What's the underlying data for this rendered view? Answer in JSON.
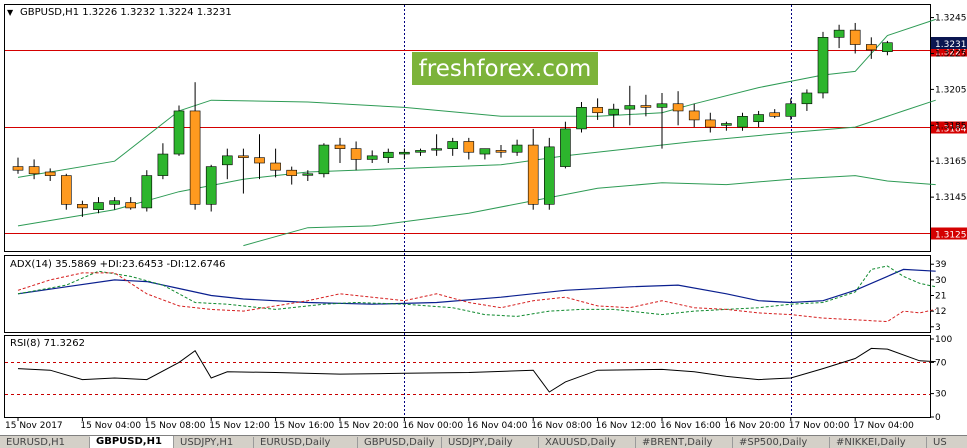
{
  "colors": {
    "bull": "#2db52d",
    "bear": "#ff9a1f",
    "bollinger": "#2e9b55",
    "level_line": "#d40000",
    "separator": "#00007f",
    "adx_line": "#0a1f8f",
    "plus_di": "#0f8a2e",
    "minus_di": "#d62020",
    "rsi_line": "#000000",
    "rsi_level": "#c80000",
    "watermark_bg": "#7cb33a",
    "current_price_bg": "#0b1650"
  },
  "watermark": "freshforex.com",
  "tabs": [
    {
      "label": "EURUSD,H1",
      "active": false
    },
    {
      "label": "GBPUSD,H1",
      "active": true
    },
    {
      "label": "USDJPY,H1",
      "active": false
    },
    {
      "label": "EURUSD,Daily",
      "active": false
    },
    {
      "label": "GBPUSD,Daily",
      "active": false
    },
    {
      "label": "USDJPY,Daily",
      "active": false
    },
    {
      "label": "XAUUSD,Daily",
      "active": false
    },
    {
      "label": "#BRENT,Daily",
      "active": false
    },
    {
      "label": "#SP500,Daily",
      "active": false
    },
    {
      "label": "#NIKKEI,Daily",
      "active": false
    },
    {
      "label": "US",
      "active": false
    }
  ],
  "chart_data": [
    {
      "type": "candlestick",
      "title": "GBPUSD,H1  1.3226 1.3232 1.3224 1.3231",
      "symbol_arrow": "▼",
      "ylim": [
        1.3115,
        1.3252
      ],
      "yticks": [
        "1.3245",
        "1.3225",
        "1.3205",
        "1.3185",
        "1.3165",
        "1.3145"
      ],
      "ytick_values": [
        1.3245,
        1.3225,
        1.3205,
        1.3185,
        1.3165,
        1.3145
      ],
      "horizontal_levels": [
        {
          "value": 1.3227,
          "label": "1.3227"
        },
        {
          "value": 1.3184,
          "label": "1.3184"
        },
        {
          "value": 1.3125,
          "label": "1.3125"
        }
      ],
      "current_price": {
        "value": 1.3231,
        "label": "1.3231"
      },
      "day_separators_at_index": [
        24,
        48
      ],
      "candles": [
        {
          "o": 1.3162,
          "h": 1.3167,
          "l": 1.3158,
          "c": 1.316
        },
        {
          "o": 1.3162,
          "h": 1.3166,
          "l": 1.3155,
          "c": 1.3158
        },
        {
          "o": 1.3159,
          "h": 1.3161,
          "l": 1.3154,
          "c": 1.3157
        },
        {
          "o": 1.3157,
          "h": 1.3158,
          "l": 1.3138,
          "c": 1.3141
        },
        {
          "o": 1.3141,
          "h": 1.3143,
          "l": 1.3134,
          "c": 1.3139
        },
        {
          "o": 1.3138,
          "h": 1.3145,
          "l": 1.3136,
          "c": 1.3142
        },
        {
          "o": 1.3141,
          "h": 1.3145,
          "l": 1.3138,
          "c": 1.3143
        },
        {
          "o": 1.3142,
          "h": 1.3145,
          "l": 1.3138,
          "c": 1.3139
        },
        {
          "o": 1.3139,
          "h": 1.316,
          "l": 1.3137,
          "c": 1.3157
        },
        {
          "o": 1.3157,
          "h": 1.3175,
          "l": 1.3155,
          "c": 1.3169
        },
        {
          "o": 1.3169,
          "h": 1.3196,
          "l": 1.3168,
          "c": 1.3193
        },
        {
          "o": 1.3193,
          "h": 1.3209,
          "l": 1.3138,
          "c": 1.3141
        },
        {
          "o": 1.3141,
          "h": 1.3163,
          "l": 1.3137,
          "c": 1.3162
        },
        {
          "o": 1.3163,
          "h": 1.3172,
          "l": 1.3155,
          "c": 1.3168
        },
        {
          "o": 1.3168,
          "h": 1.3172,
          "l": 1.3147,
          "c": 1.3167
        },
        {
          "o": 1.3167,
          "h": 1.318,
          "l": 1.3155,
          "c": 1.3164
        },
        {
          "o": 1.3164,
          "h": 1.3172,
          "l": 1.3156,
          "c": 1.316
        },
        {
          "o": 1.316,
          "h": 1.3162,
          "l": 1.3152,
          "c": 1.3157
        },
        {
          "o": 1.3158,
          "h": 1.316,
          "l": 1.3154,
          "c": 1.3158
        },
        {
          "o": 1.3158,
          "h": 1.3175,
          "l": 1.3156,
          "c": 1.3174
        },
        {
          "o": 1.3174,
          "h": 1.3178,
          "l": 1.3164,
          "c": 1.3172
        },
        {
          "o": 1.3172,
          "h": 1.3176,
          "l": 1.316,
          "c": 1.3166
        },
        {
          "o": 1.3166,
          "h": 1.3171,
          "l": 1.3164,
          "c": 1.3168
        },
        {
          "o": 1.3167,
          "h": 1.3172,
          "l": 1.3164,
          "c": 1.317
        },
        {
          "o": 1.3169,
          "h": 1.3172,
          "l": 1.3166,
          "c": 1.317
        },
        {
          "o": 1.317,
          "h": 1.3172,
          "l": 1.3168,
          "c": 1.3171
        },
        {
          "o": 1.3172,
          "h": 1.318,
          "l": 1.3168,
          "c": 1.3172
        },
        {
          "o": 1.3172,
          "h": 1.3178,
          "l": 1.3168,
          "c": 1.3176
        },
        {
          "o": 1.3176,
          "h": 1.3178,
          "l": 1.3166,
          "c": 1.317
        },
        {
          "o": 1.3169,
          "h": 1.3172,
          "l": 1.3166,
          "c": 1.3172
        },
        {
          "o": 1.3171,
          "h": 1.3174,
          "l": 1.3167,
          "c": 1.317
        },
        {
          "o": 1.317,
          "h": 1.3177,
          "l": 1.3168,
          "c": 1.3174
        },
        {
          "o": 1.3174,
          "h": 1.3183,
          "l": 1.3138,
          "c": 1.3141
        },
        {
          "o": 1.3141,
          "h": 1.3178,
          "l": 1.3138,
          "c": 1.3173
        },
        {
          "o": 1.3162,
          "h": 1.3187,
          "l": 1.3161,
          "c": 1.3183
        },
        {
          "o": 1.3183,
          "h": 1.3198,
          "l": 1.3181,
          "c": 1.3195
        },
        {
          "o": 1.3195,
          "h": 1.32,
          "l": 1.3188,
          "c": 1.3192
        },
        {
          "o": 1.3191,
          "h": 1.3197,
          "l": 1.3184,
          "c": 1.3194
        },
        {
          "o": 1.3194,
          "h": 1.3207,
          "l": 1.3185,
          "c": 1.3196
        },
        {
          "o": 1.3196,
          "h": 1.3202,
          "l": 1.319,
          "c": 1.3195
        },
        {
          "o": 1.3195,
          "h": 1.3203,
          "l": 1.3172,
          "c": 1.3197
        },
        {
          "o": 1.3197,
          "h": 1.3204,
          "l": 1.3185,
          "c": 1.3193
        },
        {
          "o": 1.3193,
          "h": 1.3197,
          "l": 1.3184,
          "c": 1.3188
        },
        {
          "o": 1.3188,
          "h": 1.3192,
          "l": 1.3181,
          "c": 1.3184
        },
        {
          "o": 1.3185,
          "h": 1.3187,
          "l": 1.3182,
          "c": 1.3186
        },
        {
          "o": 1.3184,
          "h": 1.3192,
          "l": 1.3182,
          "c": 1.319
        },
        {
          "o": 1.3187,
          "h": 1.3193,
          "l": 1.3184,
          "c": 1.3191
        },
        {
          "o": 1.3192,
          "h": 1.3194,
          "l": 1.3189,
          "c": 1.319
        },
        {
          "o": 1.319,
          "h": 1.32,
          "l": 1.3188,
          "c": 1.3197
        },
        {
          "o": 1.3197,
          "h": 1.3205,
          "l": 1.3193,
          "c": 1.3203
        },
        {
          "o": 1.3203,
          "h": 1.3237,
          "l": 1.32,
          "c": 1.3234
        },
        {
          "o": 1.3234,
          "h": 1.3241,
          "l": 1.3228,
          "c": 1.3238
        },
        {
          "o": 1.3238,
          "h": 1.3242,
          "l": 1.3225,
          "c": 1.323
        },
        {
          "o": 1.323,
          "h": 1.3234,
          "l": 1.3222,
          "c": 1.3227
        },
        {
          "o": 1.3226,
          "h": 1.3232,
          "l": 1.3224,
          "c": 1.3231
        }
      ],
      "bollinger": {
        "upper": [
          [
            0,
            1.3156
          ],
          [
            6,
            1.3165
          ],
          [
            10,
            1.3193
          ],
          [
            12,
            1.3199
          ],
          [
            18,
            1.3198
          ],
          [
            24,
            1.3195
          ],
          [
            30,
            1.319
          ],
          [
            36,
            1.319
          ],
          [
            40,
            1.3192
          ],
          [
            42,
            1.3197
          ],
          [
            46,
            1.3206
          ],
          [
            50,
            1.3213
          ],
          [
            52,
            1.3215
          ],
          [
            54,
            1.3235
          ],
          [
            57,
            1.3244
          ]
        ],
        "middle": [
          [
            0,
            1.3129
          ],
          [
            6,
            1.3138
          ],
          [
            10,
            1.3148
          ],
          [
            14,
            1.3155
          ],
          [
            18,
            1.3159
          ],
          [
            24,
            1.3161
          ],
          [
            30,
            1.3163
          ],
          [
            34,
            1.3168
          ],
          [
            38,
            1.3172
          ],
          [
            42,
            1.3176
          ],
          [
            48,
            1.3181
          ],
          [
            52,
            1.3184
          ],
          [
            55,
            1.3193
          ],
          [
            57,
            1.3199
          ]
        ],
        "lower": [
          [
            14,
            1.3118
          ],
          [
            18,
            1.3128
          ],
          [
            22,
            1.3129
          ],
          [
            28,
            1.3136
          ],
          [
            32,
            1.3143
          ],
          [
            36,
            1.315
          ],
          [
            40,
            1.3153
          ],
          [
            44,
            1.3152
          ],
          [
            48,
            1.3155
          ],
          [
            52,
            1.3157
          ],
          [
            54,
            1.3154
          ],
          [
            57,
            1.3152
          ]
        ]
      }
    },
    {
      "type": "line",
      "title": "ADX(14) 35.5869 +DI:23.6453 -DI:12.6746",
      "ylim": [
        0,
        42
      ],
      "yticks": [
        "39",
        "30",
        "21",
        "12",
        "3"
      ],
      "ytick_values": [
        39,
        30,
        21,
        12,
        3
      ],
      "series": [
        {
          "name": "ADX(14)",
          "values": [
            [
              0,
              22
            ],
            [
              3,
              26
            ],
            [
              6,
              30
            ],
            [
              8,
              29
            ],
            [
              10,
              25
            ],
            [
              12,
              21
            ],
            [
              14,
              19
            ],
            [
              18,
              17
            ],
            [
              22,
              16
            ],
            [
              26,
              17
            ],
            [
              30,
              20
            ],
            [
              34,
              24
            ],
            [
              38,
              26
            ],
            [
              41,
              27
            ],
            [
              44,
              22
            ],
            [
              46,
              18
            ],
            [
              48,
              17
            ],
            [
              50,
              18
            ],
            [
              52,
              24
            ],
            [
              54,
              32
            ],
            [
              55,
              36
            ],
            [
              57,
              35
            ]
          ]
        },
        {
          "name": "+DI",
          "values": [
            [
              0,
              22
            ],
            [
              3,
              27
            ],
            [
              5,
              35
            ],
            [
              7,
              32
            ],
            [
              9,
              27
            ],
            [
              11,
              17
            ],
            [
              13,
              16
            ],
            [
              16,
              13
            ],
            [
              19,
              16
            ],
            [
              21,
              17
            ],
            [
              24,
              16
            ],
            [
              27,
              14
            ],
            [
              29,
              10
            ],
            [
              31,
              9
            ],
            [
              33,
              12
            ],
            [
              35,
              13
            ],
            [
              37,
              13
            ],
            [
              40,
              10
            ],
            [
              42,
              12
            ],
            [
              44,
              13
            ],
            [
              46,
              14
            ],
            [
              48,
              16
            ],
            [
              50,
              17
            ],
            [
              52,
              23
            ],
            [
              53,
              36
            ],
            [
              54,
              38
            ],
            [
              55,
              32
            ],
            [
              56,
              28
            ],
            [
              57,
              26
            ]
          ]
        },
        {
          "name": "-DI",
          "values": [
            [
              0,
              24
            ],
            [
              2,
              30
            ],
            [
              4,
              34
            ],
            [
              6,
              34
            ],
            [
              8,
              22
            ],
            [
              10,
              15
            ],
            [
              12,
              13
            ],
            [
              14,
              12
            ],
            [
              16,
              15
            ],
            [
              18,
              18
            ],
            [
              20,
              22
            ],
            [
              22,
              20
            ],
            [
              24,
              18
            ],
            [
              26,
              22
            ],
            [
              28,
              17
            ],
            [
              30,
              14
            ],
            [
              32,
              18
            ],
            [
              34,
              20
            ],
            [
              36,
              15
            ],
            [
              38,
              14
            ],
            [
              40,
              18
            ],
            [
              42,
              14
            ],
            [
              44,
              13
            ],
            [
              46,
              11
            ],
            [
              48,
              10
            ],
            [
              50,
              8
            ],
            [
              52,
              7
            ],
            [
              54,
              6
            ],
            [
              55,
              12
            ],
            [
              56,
              11
            ],
            [
              57,
              13
            ]
          ]
        }
      ]
    },
    {
      "type": "line",
      "title": "RSI(8) 71.3262",
      "ylim": [
        0,
        100
      ],
      "yticks": [
        "100",
        "70",
        "30",
        "0"
      ],
      "ytick_values": [
        100,
        70,
        30,
        0
      ],
      "levels": [
        70,
        30
      ],
      "series": [
        {
          "name": "RSI(8)",
          "values": [
            [
              0,
              62
            ],
            [
              2,
              60
            ],
            [
              4,
              48
            ],
            [
              6,
              50
            ],
            [
              8,
              48
            ],
            [
              10,
              70
            ],
            [
              11,
              85
            ],
            [
              12,
              50
            ],
            [
              13,
              58
            ],
            [
              16,
              57
            ],
            [
              20,
              55
            ],
            [
              24,
              56
            ],
            [
              28,
              57
            ],
            [
              32,
              60
            ],
            [
              33,
              32
            ],
            [
              34,
              45
            ],
            [
              36,
              60
            ],
            [
              40,
              61
            ],
            [
              42,
              58
            ],
            [
              44,
              52
            ],
            [
              46,
              48
            ],
            [
              48,
              50
            ],
            [
              50,
              62
            ],
            [
              52,
              75
            ],
            [
              53,
              88
            ],
            [
              54,
              87
            ],
            [
              56,
              72
            ],
            [
              57,
              71
            ]
          ]
        }
      ]
    }
  ],
  "x_axis": {
    "labels": [
      "15 Nov 2017",
      "15 Nov 04:00",
      "15 Nov 08:00",
      "15 Nov 12:00",
      "15 Nov 16:00",
      "15 Nov 20:00",
      "16 Nov 00:00",
      "16 Nov 04:00",
      "16 Nov 08:00",
      "16 Nov 12:00",
      "16 Nov 16:00",
      "16 Nov 20:00",
      "17 Nov 00:00",
      "17 Nov 04:00"
    ],
    "label_index": [
      0,
      4,
      8,
      12,
      16,
      20,
      24,
      28,
      32,
      36,
      40,
      44,
      48,
      52
    ]
  }
}
